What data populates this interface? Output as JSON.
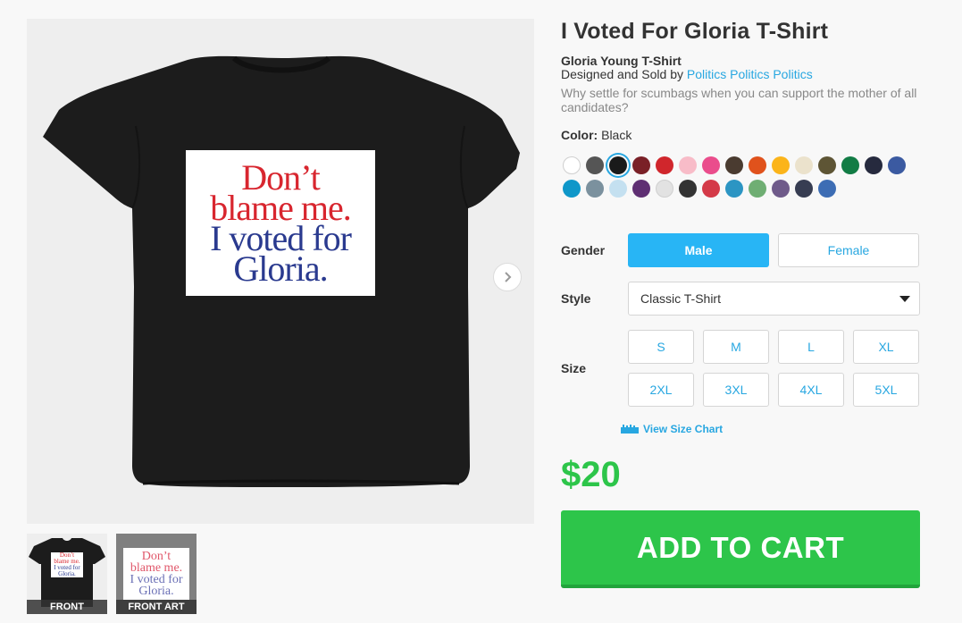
{
  "product": {
    "title": "I Voted For Gloria T-Shirt",
    "subtitle": "Gloria Young T-Shirt",
    "designed_prefix": "Designed and Sold by ",
    "designer": "Politics Politics Politics",
    "description": "Why settle for scumbags when you can support the mother of all candidates?"
  },
  "design_text": {
    "line1": "Don’t",
    "line2": "blame me.",
    "line3": "I voted for",
    "line4": "Gloria."
  },
  "thumbnails": [
    {
      "label": "FRONT"
    },
    {
      "label": "FRONT ART"
    }
  ],
  "color": {
    "label": "Color:",
    "selected": "Black",
    "swatches": [
      "#ffffff",
      "#555555",
      "#1a1a1a",
      "#7a2027",
      "#d0262c",
      "#f8bcc8",
      "#ea4d8c",
      "#4a3b30",
      "#e0521c",
      "#fbb41a",
      "#ebe2cc",
      "#5e5535",
      "#127c45",
      "#262a3e",
      "#3b5aa1",
      "#0f97c9",
      "#7b919e",
      "#c4e0f0",
      "#5f2f73",
      "#e2e2e2",
      "#333333",
      "#d43a48",
      "#2c95c3",
      "#6fae73",
      "#6f5b8a",
      "#373d52",
      "#3d6db4"
    ]
  },
  "gender": {
    "label": "Gender",
    "options": [
      "Male",
      "Female"
    ],
    "selected": "Male"
  },
  "style": {
    "label": "Style",
    "selected": "Classic T-Shirt"
  },
  "size": {
    "label": "Size",
    "options": [
      "S",
      "M",
      "L",
      "XL",
      "2XL",
      "3XL",
      "4XL",
      "5XL"
    ],
    "chart_link": "View Size Chart"
  },
  "price": "$20",
  "cart_label": "ADD TO CART",
  "colors": {
    "accent_blue": "#28a7e1",
    "selected_blue": "#28b5f5",
    "price_green": "#2dc54a"
  }
}
